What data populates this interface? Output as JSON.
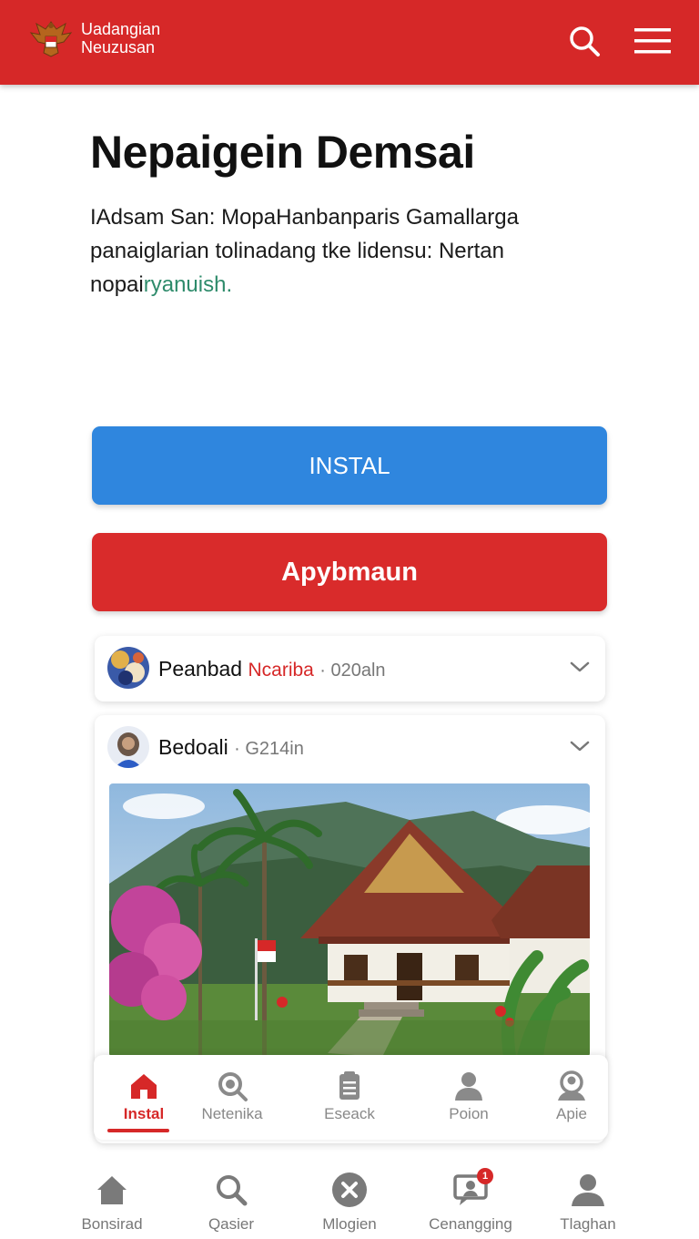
{
  "header": {
    "brand_line1": "Uadangian",
    "brand_line2": "Neuzusan",
    "icons": {
      "logo": "garuda-emblem",
      "search": "search-icon",
      "menu": "hamburger-menu-icon"
    }
  },
  "hero": {
    "title": "Nepaigein Demsai",
    "description_main": "IAdsam San: MopaHanbanparis Gamallarga panaiglarian tolinadang tke lidensu: Nertan nopai",
    "description_accent": "ryanuish."
  },
  "buttons": {
    "install_label": "INSTAL",
    "secondary_label": "Apybmaun"
  },
  "posts": [
    {
      "name": "Peanbad",
      "subtitle": "Ncariba",
      "meta": "· 020aln"
    },
    {
      "name": "Bedoali",
      "meta": "· G214in"
    }
  ],
  "tabbar": {
    "active_index": 0,
    "items": [
      {
        "label": "Instal",
        "icon": "home-icon"
      },
      {
        "label": "Netenika",
        "icon": "search-icon"
      },
      {
        "label": "Eseack",
        "icon": "clipboard-icon"
      },
      {
        "label": "Poion",
        "icon": "user-icon"
      },
      {
        "label": "Apie",
        "icon": "user-search-icon"
      }
    ]
  },
  "bottom_nav": {
    "items": [
      {
        "label": "Bonsirad",
        "icon": "home-icon"
      },
      {
        "label": "Qasier",
        "icon": "search-icon"
      },
      {
        "label": "Mlogien",
        "icon": "close-circle-icon"
      },
      {
        "label": "Cenangging",
        "icon": "chat-icon",
        "badge": "1"
      },
      {
        "label": "Tlaghan",
        "icon": "user-icon"
      }
    ]
  },
  "colors": {
    "header_red": "#d62828",
    "install_blue": "#2f86de",
    "accent_green": "#2e8b6b"
  }
}
